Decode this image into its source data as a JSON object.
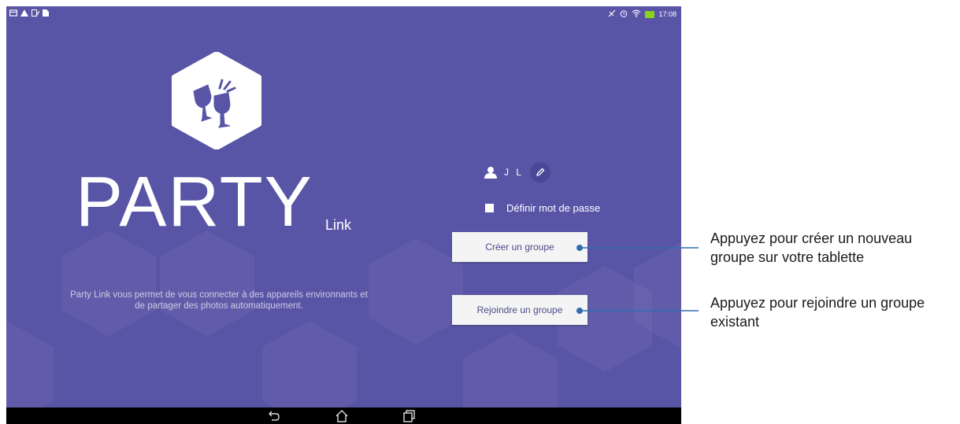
{
  "status_bar": {
    "time": "17:08",
    "left_icons": [
      "notification-icon",
      "warning-icon",
      "sim-icon",
      "file-icon"
    ],
    "right_icons": [
      "no-sim-icon",
      "alarm-icon",
      "wifi-icon",
      "battery-charging-icon"
    ],
    "battery_color": "#8bd11f"
  },
  "app": {
    "title": "PARTY",
    "subtitle": "Link",
    "description": "Party Link vous permet de vous connecter à des appareils environnants et de partager des photos automatiquement.",
    "background_color": "#5955a6",
    "icon": "party-link-cheers-icon"
  },
  "user": {
    "initials": "J L",
    "edit_icon": "pencil-icon"
  },
  "password_option": {
    "label": "Définir mot de passe",
    "checked": false
  },
  "buttons": {
    "create_group": "Créer un groupe",
    "join_group": "Rejoindre un groupe"
  },
  "nav_bar": {
    "icons": [
      "back-icon",
      "home-icon",
      "recent-apps-icon"
    ]
  },
  "callouts": {
    "create": "Appuyez pour créer un nouveau groupe sur votre tablette",
    "join": "Appuyez pour rejoindre un groupe existant",
    "line_color": "#2f6db1"
  }
}
